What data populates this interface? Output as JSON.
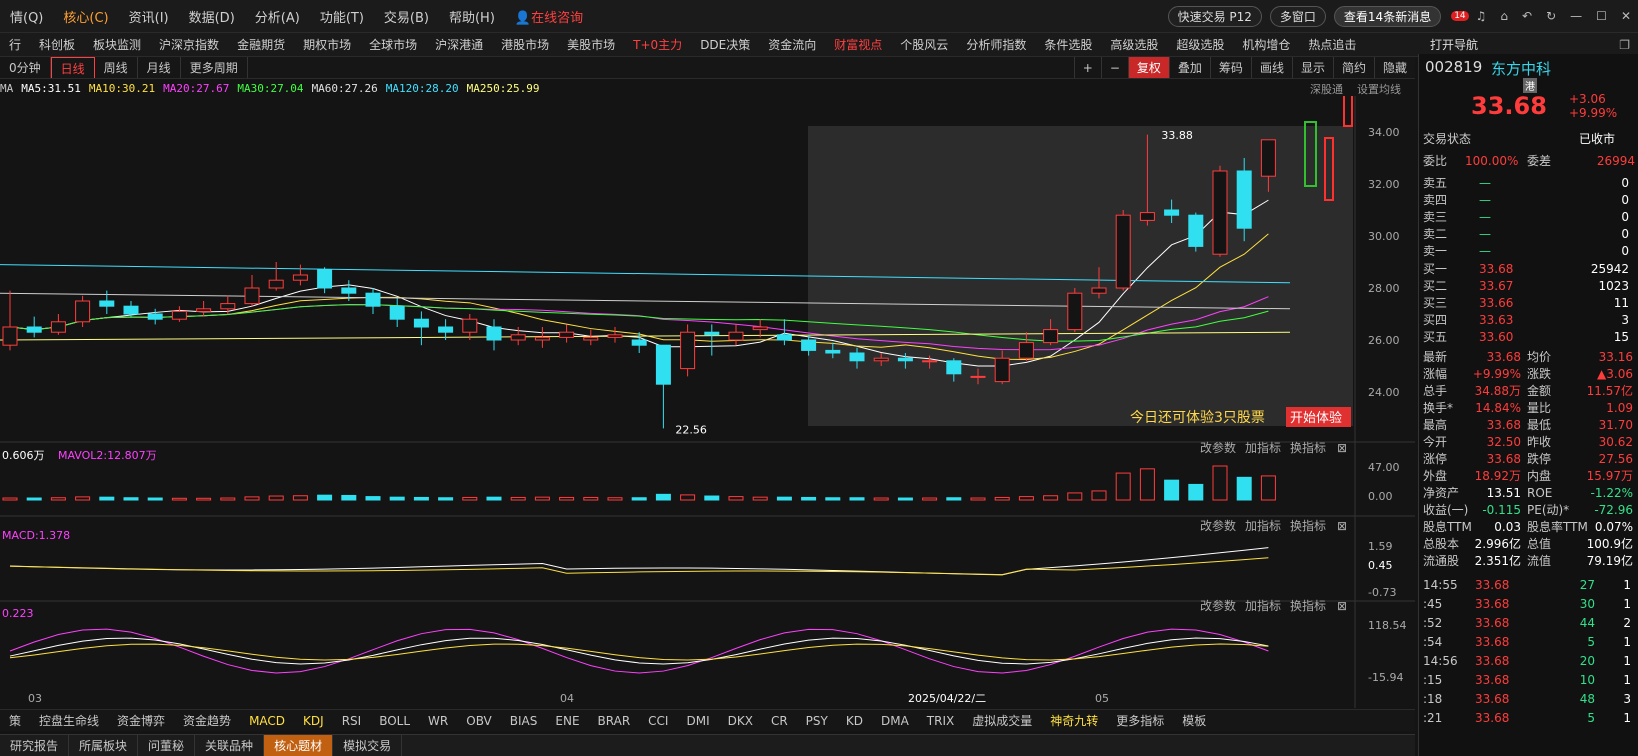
{
  "menu": {
    "items": [
      "情(Q)",
      "核心(C)",
      "资讯(I)",
      "数据(D)",
      "分析(A)",
      "功能(T)",
      "交易(B)",
      "帮助(H)"
    ],
    "active": 1,
    "consult": "在线咨询",
    "quick_trade": "快速交易 P12",
    "multi_window": "多窗口",
    "news": "查看14条新消息",
    "badge": "14"
  },
  "nav": {
    "items": [
      "行",
      "科创板",
      "板块监测",
      "沪深京指数",
      "金融期货",
      "期权市场",
      "全球市场",
      "沪深港通",
      "港股市场",
      "美股市场",
      "T+0主力",
      "DDE决策",
      "资金流向",
      "财富视点",
      "个股风云",
      "分析师指数",
      "条件选股",
      "高级选股",
      "超级选股",
      "机构增仓",
      "热点追击"
    ],
    "red": [
      10,
      13
    ],
    "right": "打开导航"
  },
  "period": {
    "items": [
      "0分钟",
      "日线",
      "周线",
      "月线",
      "更多周期"
    ],
    "selected": 1,
    "tools": [
      "复权",
      "叠加",
      "筹码",
      "画线",
      "显示",
      "简约",
      "隐藏"
    ],
    "tool_red": 0
  },
  "ma": {
    "head": "MA",
    "items": [
      {
        "t": "MA5:31.51",
        "c": "#ffffff"
      },
      {
        "t": "MA10:30.21",
        "c": "#ffe040"
      },
      {
        "t": "MA20:27.67",
        "c": "#ff40ff"
      },
      {
        "t": "MA30:27.04",
        "c": "#40ff40"
      },
      {
        "t": "MA60:27.26",
        "c": "#e0e0e0"
      },
      {
        "t": "MA120:28.20",
        "c": "#40e0ff"
      },
      {
        "t": "MA250:25.99",
        "c": "#ffff80"
      }
    ],
    "right": [
      "深股通",
      "设置均线"
    ]
  },
  "chart_data": {
    "type": "candlestick",
    "price_labels": [
      "34.00",
      "32.00",
      "30.00",
      "28.00",
      "26.00",
      "24.00"
    ],
    "price_range": [
      22.5,
      35.0
    ],
    "high_label": "33.88",
    "low_label": "22.56",
    "vol_labels": [
      "47.00",
      "0.00"
    ],
    "macd_labels": [
      "1.59",
      "0.45",
      "-0.73"
    ],
    "kdj_labels": [
      "118.54",
      "-15.94"
    ],
    "date_labels": [
      "03",
      "04",
      "2025/04/22/二",
      "05"
    ],
    "volume_title": "0.606万",
    "mavol2": "MAVOL2:12.807万",
    "macd_title": "MACD:1.378",
    "kdj_title": "0.223",
    "panel_buttons": [
      "改参数",
      "加指标",
      "换指标"
    ],
    "promo": "今日还可体验3只股票",
    "promo_btn": "开始体验",
    "candles": [
      [
        25.8,
        26.5,
        27.9,
        25.6
      ],
      [
        26.5,
        26.3,
        26.9,
        26.1
      ],
      [
        26.3,
        26.7,
        27.0,
        26.2
      ],
      [
        26.7,
        27.5,
        27.7,
        26.5
      ],
      [
        27.5,
        27.3,
        27.9,
        27.0
      ],
      [
        27.3,
        27.0,
        27.5,
        26.9
      ],
      [
        27.0,
        26.8,
        27.2,
        26.6
      ],
      [
        26.8,
        27.1,
        27.3,
        26.7
      ],
      [
        27.1,
        27.2,
        27.5,
        26.9
      ],
      [
        27.2,
        27.4,
        27.7,
        27.0
      ],
      [
        27.4,
        28.0,
        28.5,
        27.3
      ],
      [
        28.0,
        28.3,
        29.0,
        27.9
      ],
      [
        28.3,
        28.5,
        28.9,
        28.1
      ],
      [
        28.7,
        28.0,
        28.8,
        27.8
      ],
      [
        28.0,
        27.8,
        28.3,
        27.5
      ],
      [
        27.8,
        27.3,
        28.0,
        27.0
      ],
      [
        27.3,
        26.8,
        27.6,
        26.5
      ],
      [
        26.8,
        26.5,
        27.1,
        25.8
      ],
      [
        26.5,
        26.3,
        26.8,
        26.0
      ],
      [
        26.3,
        26.8,
        27.0,
        26.0
      ],
      [
        26.5,
        26.0,
        26.8,
        25.6
      ],
      [
        26.0,
        26.2,
        26.5,
        25.8
      ],
      [
        26.0,
        26.1,
        26.5,
        25.7
      ],
      [
        26.1,
        26.3,
        26.6,
        25.9
      ],
      [
        26.0,
        26.1,
        26.4,
        25.8
      ],
      [
        26.1,
        26.2,
        26.5,
        25.9
      ],
      [
        26.0,
        25.8,
        26.3,
        25.5
      ],
      [
        25.8,
        24.3,
        25.8,
        22.6
      ],
      [
        24.9,
        26.3,
        26.6,
        24.6
      ],
      [
        26.3,
        26.2,
        26.6,
        25.4
      ],
      [
        26.0,
        26.3,
        26.6,
        25.8
      ],
      [
        26.4,
        26.5,
        26.8,
        26.1
      ],
      [
        26.2,
        26.0,
        26.8,
        25.8
      ],
      [
        26.0,
        25.6,
        26.2,
        25.4
      ],
      [
        25.6,
        25.5,
        25.9,
        25.3
      ],
      [
        25.5,
        25.2,
        25.7,
        24.9
      ],
      [
        25.2,
        25.3,
        25.5,
        25.0
      ],
      [
        25.3,
        25.2,
        25.5,
        24.9
      ],
      [
        25.2,
        25.2,
        25.4,
        24.9
      ],
      [
        25.2,
        24.7,
        25.3,
        24.4
      ],
      [
        24.6,
        24.6,
        24.9,
        24.3
      ],
      [
        24.4,
        25.3,
        25.6,
        24.3
      ],
      [
        25.3,
        25.9,
        26.3,
        25.2
      ],
      [
        25.9,
        26.4,
        26.8,
        25.8
      ],
      [
        26.4,
        27.8,
        28.0,
        26.3
      ],
      [
        27.8,
        28.0,
        28.8,
        27.6
      ],
      [
        28.0,
        30.8,
        31.0,
        27.9
      ],
      [
        30.6,
        30.9,
        33.9,
        30.4
      ],
      [
        31.0,
        30.8,
        31.4,
        30.5
      ],
      [
        30.8,
        29.6,
        30.9,
        29.4
      ],
      [
        29.3,
        32.5,
        32.7,
        29.2
      ],
      [
        32.5,
        30.3,
        33.0,
        29.8
      ],
      [
        32.3,
        33.7,
        33.7,
        31.7
      ]
    ],
    "volumes": [
      0.7,
      0.7,
      0.8,
      1.1,
      1.0,
      0.8,
      0.7,
      0.6,
      0.6,
      0.7,
      1.1,
      1.4,
      1.5,
      1.7,
      1.6,
      1.2,
      1.0,
      0.9,
      0.8,
      0.9,
      1.0,
      0.9,
      1.0,
      0.9,
      0.9,
      0.8,
      0.8,
      2.0,
      1.8,
      1.4,
      1.2,
      1.0,
      1.0,
      0.9,
      0.8,
      0.8,
      0.7,
      0.7,
      0.7,
      0.8,
      0.7,
      0.9,
      1.2,
      1.5,
      2.5,
      3.2,
      9.5,
      11.0,
      7.0,
      5.5,
      12.0,
      8.0,
      8.5
    ]
  },
  "quote": {
    "code": "002819",
    "name": "东方中科",
    "tag": "港",
    "price": "33.68",
    "change": "+3.06",
    "pct": "+9.99%",
    "status_label": "交易状态",
    "status": "已收市",
    "wb_label": "委比",
    "wb": "100.00%",
    "wc_label": "委差",
    "wc": "26994",
    "sell": [
      [
        "卖五",
        "—",
        "0"
      ],
      [
        "卖四",
        "—",
        "0"
      ],
      [
        "卖三",
        "—",
        "0"
      ],
      [
        "卖二",
        "—",
        "0"
      ],
      [
        "卖一",
        "—",
        "0"
      ]
    ],
    "buy": [
      [
        "买一",
        "33.68",
        "25942"
      ],
      [
        "买二",
        "33.67",
        "1023"
      ],
      [
        "买三",
        "33.66",
        "11"
      ],
      [
        "买四",
        "33.63",
        "3"
      ],
      [
        "买五",
        "33.60",
        "15"
      ]
    ],
    "stats": [
      [
        "最新",
        "33.68",
        "均价",
        "33.16"
      ],
      [
        "涨幅",
        "+9.99%",
        "涨跌",
        "▲3.06"
      ],
      [
        "总手",
        "34.88万",
        "金额",
        "11.57亿"
      ],
      [
        "换手*",
        "14.84%",
        "量比",
        "1.09"
      ],
      [
        "最高",
        "33.68",
        "最低",
        "31.70"
      ],
      [
        "今开",
        "32.50",
        "昨收",
        "30.62"
      ],
      [
        "涨停",
        "33.68",
        "跌停",
        "27.56"
      ],
      [
        "外盘",
        "18.92万",
        "内盘",
        "15.97万"
      ],
      [
        "净资产",
        "13.51",
        "ROE",
        "-1.22%"
      ],
      [
        "收益(一)",
        "-0.115",
        "PE(动)*",
        "-72.96"
      ],
      [
        "股息TTM",
        "0.03",
        "股息率TTM",
        "0.07%"
      ],
      [
        "总股本",
        "2.996亿",
        "总值",
        "100.9亿"
      ],
      [
        "流通股",
        "2.351亿",
        "流值",
        "79.19亿"
      ]
    ],
    "ticks": [
      [
        "14:55",
        "33.68",
        "27",
        "1"
      ],
      [
        ":45",
        "33.68",
        "30",
        "1"
      ],
      [
        ":52",
        "33.68",
        "44",
        "2"
      ],
      [
        ":54",
        "33.68",
        "5",
        "1"
      ],
      [
        "14:56",
        "33.68",
        "20",
        "1"
      ],
      [
        ":15",
        "33.68",
        "10",
        "1"
      ],
      [
        ":18",
        "33.68",
        "48",
        "3"
      ],
      [
        ":21",
        "33.68",
        "5",
        "1"
      ]
    ]
  },
  "indicators": [
    "策",
    "控盘生命线",
    "资金博弈",
    "资金趋势",
    "MACD",
    "KDJ",
    "RSI",
    "BOLL",
    "WR",
    "OBV",
    "BIAS",
    "ENE",
    "BRAR",
    "CCI",
    "DMI",
    "DKX",
    "CR",
    "PSY",
    "KD",
    "DMA",
    "TRIX",
    "虚拟成交量",
    "神奇九转",
    "更多指标",
    "模板"
  ],
  "footer": {
    "items": [
      "研究报告",
      "所属板块",
      "问董秘",
      "关联品种",
      "核心题材",
      "模拟交易"
    ],
    "selected": 4
  }
}
